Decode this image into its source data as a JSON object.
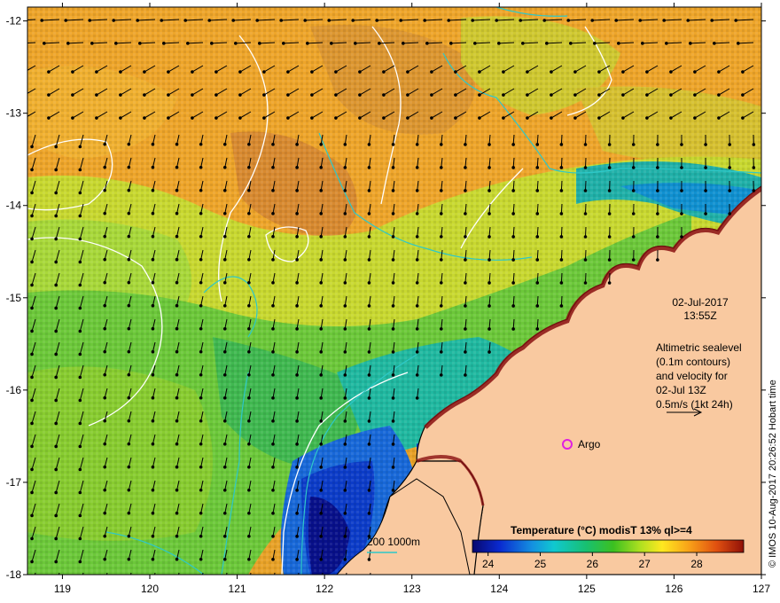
{
  "map": {
    "lon_ticks": [
      "119",
      "120",
      "121",
      "122",
      "123",
      "124",
      "125",
      "126",
      "127"
    ],
    "lat_ticks": [
      "-12",
      "-13",
      "-14",
      "-15",
      "-16",
      "-17",
      "-18"
    ],
    "lon_range": [
      118.6,
      127.0
    ],
    "lat_range": [
      -11.85,
      -18.0
    ]
  },
  "annotations": {
    "date": "02-Jul-2017",
    "time": "13:55Z",
    "alt_line1": "Altimetric sealevel",
    "alt_line2": "(0.1m contours)",
    "alt_line3": "and velocity for",
    "alt_line4": "02-Jul 13Z",
    "alt_line5": "0.5m/s (1kt 24h)",
    "argo_label": "Argo",
    "bathymetry_legend": "200  1000m",
    "credit": "© IMOS 10-Aug-2017 20:26:52 Hobart time"
  },
  "colorbar": {
    "title": "Temperature (°C) modisT 13% ql>=4",
    "ticks": [
      "24",
      "25",
      "26",
      "27",
      "28"
    ],
    "range": [
      23.7,
      28.9
    ]
  },
  "colors": {
    "land": "#f9c9a0",
    "coast": "#000000",
    "contour": "#ffffff",
    "bathy": "#2ec8c8",
    "argo": "#e020e0"
  }
}
